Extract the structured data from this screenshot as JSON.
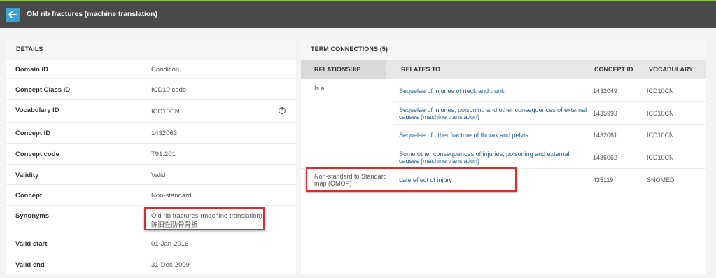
{
  "header": {
    "title": "Old rib fractures (machine translation)"
  },
  "details": {
    "heading": "DETAILS",
    "rows": [
      {
        "key": "Domain ID",
        "value": "Condition"
      },
      {
        "key": "Concept Class ID",
        "value": "ICD10 code"
      },
      {
        "key": "Vocabulary ID",
        "value": "ICD10CN"
      },
      {
        "key": "Concept ID",
        "value": "1432063"
      },
      {
        "key": "Concept code",
        "value": "T91.201"
      },
      {
        "key": "Validity",
        "value": "Valid"
      },
      {
        "key": "Concept",
        "value": "Non-standard"
      },
      {
        "key": "Synonyms",
        "value": "Old rib fractures (machine translation)",
        "value2": "陈旧性肋骨骨折"
      },
      {
        "key": "Valid start",
        "value": "01-Jan-2016"
      },
      {
        "key": "Valid end",
        "value": "31-Dec-2099"
      }
    ],
    "help_symbol": "?"
  },
  "connections": {
    "heading": "TERM CONNECTIONS (5)",
    "columns": [
      "RELATIONSHIP",
      "RELATES TO",
      "CONCEPT ID",
      "VOCABULARY"
    ],
    "rows": [
      {
        "relationship": "Is a",
        "relates_to": "Sequelae of injuries of neck and trunk",
        "concept_id": "1432049",
        "vocabulary": "ICD10CN"
      },
      {
        "relationship": "",
        "relates_to": "Sequelae of injuries, poisoning and other consequences of external causes (machine translation)",
        "concept_id": "1435993",
        "vocabulary": "ICD10CN"
      },
      {
        "relationship": "",
        "relates_to": "Sequelae of other fracture of thorax and pelvis",
        "concept_id": "1432061",
        "vocabulary": "ICD10CN"
      },
      {
        "relationship": "",
        "relates_to": "Some other consequences of injuries, poisoning and external causes (machine translation)",
        "concept_id": "1436062",
        "vocabulary": "ICD10CN"
      },
      {
        "relationship": "Non-standard to Standard map (OMOP)",
        "relates_to": "Late effect of injury",
        "concept_id": "435119",
        "vocabulary": "SNOMED"
      }
    ]
  },
  "colors": {
    "accent": "#3aa3d6",
    "link": "#1f5f8b",
    "highlight": "#d32f2f",
    "topbar": "#4a4a4a",
    "topbar_border": "#8bc34a"
  }
}
